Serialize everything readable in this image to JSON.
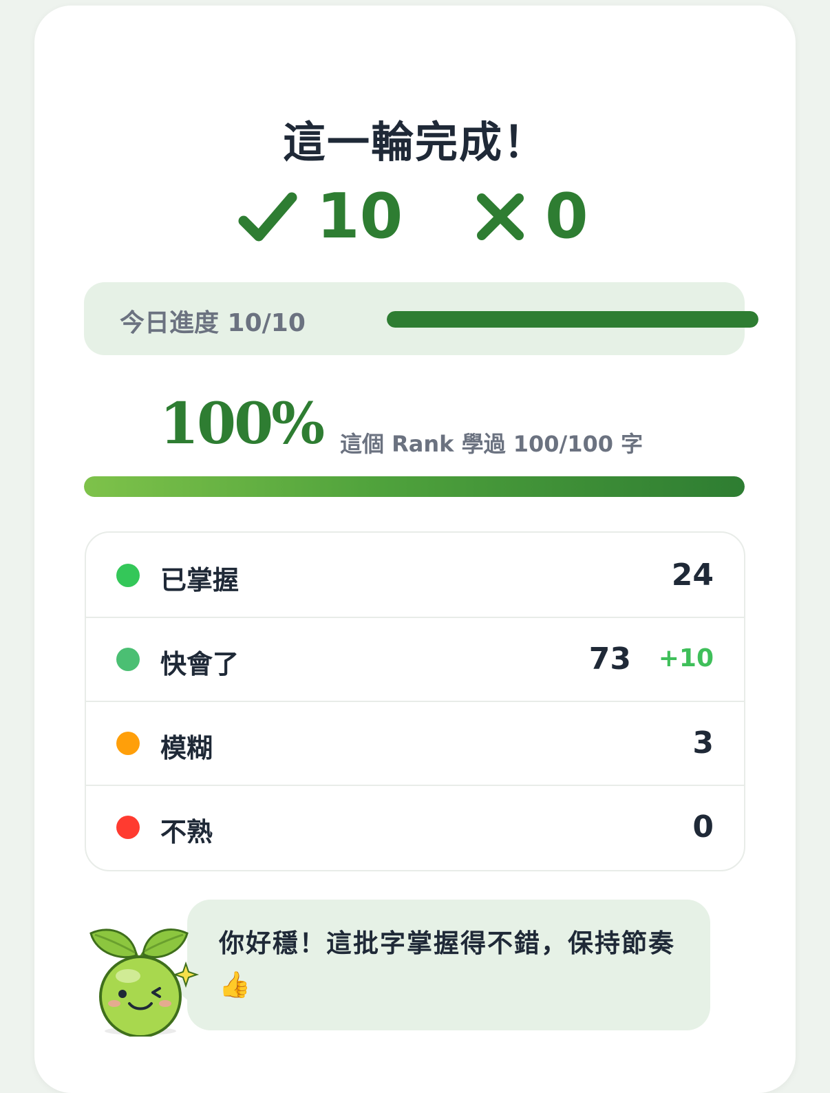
{
  "title": "這一輪完成！",
  "scores": {
    "correct": "10",
    "wrong": "0"
  },
  "today_progress": {
    "label": "今日進度 10/10",
    "fraction": 1.0
  },
  "rank": {
    "percent_label": "100%",
    "note": "這個 Rank 學過 100/100 字",
    "fraction": 1.0
  },
  "stats": [
    {
      "label": "已掌握",
      "value": "24",
      "delta": "",
      "color": "#34c759"
    },
    {
      "label": "快會了",
      "value": "73",
      "delta": "+10",
      "color": "#4bbf73"
    },
    {
      "label": "模糊",
      "value": "3",
      "delta": "",
      "color": "#ff9f0a"
    },
    {
      "label": "不熟",
      "value": "0",
      "delta": "",
      "color": "#ff3b30"
    }
  ],
  "message": {
    "text": "你好穩！這批字掌握得不錯，保持節奏 👍",
    "mascot_icon": "seedling-mascot-icon"
  },
  "colors": {
    "accent": "#2e7d32",
    "bubble_bg": "#e6f1e6",
    "delta": "#3fbf5a"
  }
}
